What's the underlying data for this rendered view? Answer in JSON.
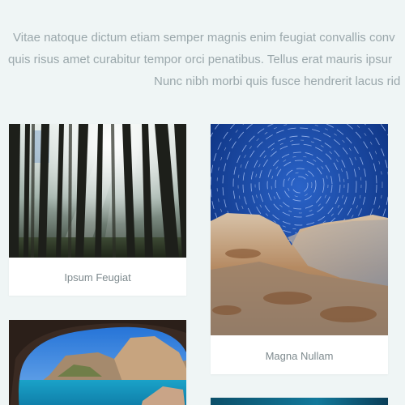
{
  "intro": {
    "line1": "Vitae natoque dictum etiam semper magnis enim feugiat convallis conv",
    "line2": "quis risus amet curabitur tempor orci penatibus. Tellus erat mauris ipsur",
    "line3": "Nunc nibh morbi quis fusce hendrerit lacus rid"
  },
  "gallery": {
    "cards": [
      {
        "caption": "Ipsum Feugiat",
        "image": "forest-sunbeams-photo"
      },
      {
        "caption": "Magna Nullam",
        "image": "star-trails-rocks-photo"
      },
      {
        "caption": "",
        "image": "sea-cave-coast-photo"
      },
      {
        "caption": "",
        "image": "ocean-photo"
      }
    ]
  },
  "colors": {
    "background": "#eff5f5",
    "text_muted": "#9aa7ab",
    "caption_text": "#7e8a8e",
    "card_background": "#ffffff"
  }
}
